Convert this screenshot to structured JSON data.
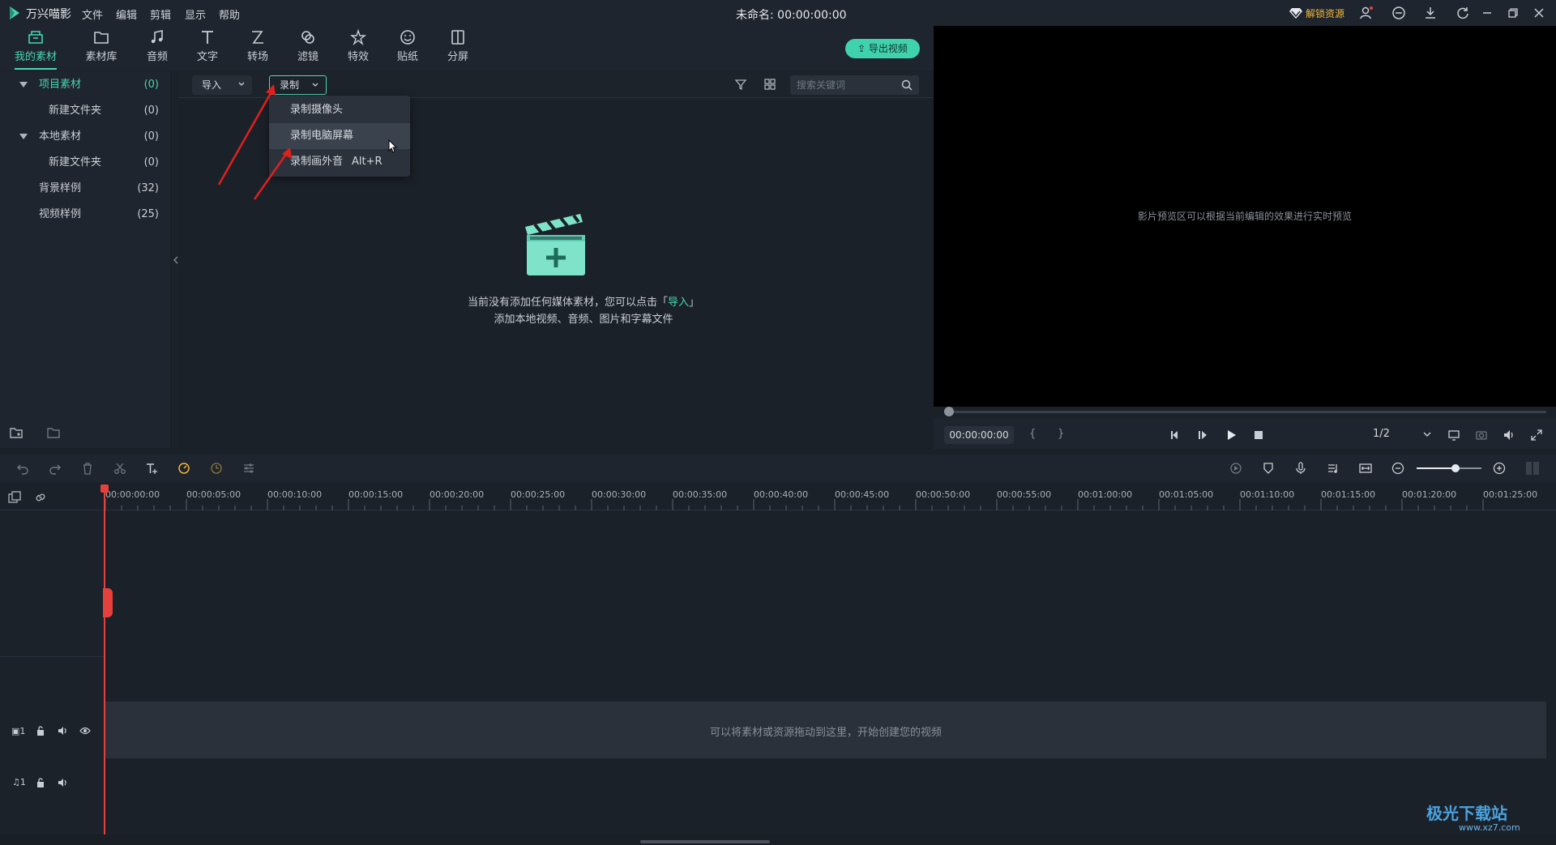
{
  "titlebar": {
    "app_name": "万兴喵影",
    "menus": [
      "文件",
      "编辑",
      "剪辑",
      "显示",
      "帮助"
    ],
    "doc_title": "未命名: 00:00:00:00",
    "unlock_label": "解锁资源",
    "window_icons": [
      "user-icon",
      "chat-icon",
      "download-icon",
      "refresh-icon",
      "minimize-icon",
      "maximize-icon",
      "close-icon"
    ]
  },
  "toolbar": {
    "tools": [
      {
        "label": "我的素材",
        "icon": "folder-box-icon",
        "active": true
      },
      {
        "label": "素材库",
        "icon": "folder-icon"
      },
      {
        "label": "音频",
        "icon": "music-icon"
      },
      {
        "label": "文字",
        "icon": "text-icon"
      },
      {
        "label": "转场",
        "icon": "transition-icon"
      },
      {
        "label": "滤镜",
        "icon": "filter-icon"
      },
      {
        "label": "特效",
        "icon": "effects-icon"
      },
      {
        "label": "贴纸",
        "icon": "sticker-icon"
      },
      {
        "label": "分屏",
        "icon": "split-screen-icon"
      }
    ],
    "export_label": "导出视频"
  },
  "left_panel": {
    "items": [
      {
        "name": "项目素材",
        "count": "(0)",
        "caret": true,
        "selected": true
      },
      {
        "name": "新建文件夹",
        "count": "(0)"
      },
      {
        "name": "本地素材",
        "count": "(0)",
        "caret": true
      },
      {
        "name": "新建文件夹",
        "count": "(0)"
      },
      {
        "name": "背景样例",
        "count": "(32)"
      },
      {
        "name": "视频样例",
        "count": "(25)"
      }
    ]
  },
  "media_toolbar": {
    "import_label": "导入",
    "record_label": "录制",
    "search_placeholder": "搜索关键词"
  },
  "record_menu": {
    "items": [
      {
        "label": "录制摄像头"
      },
      {
        "label": "录制电脑屏幕",
        "hover": true
      },
      {
        "label": "录制画外音",
        "shortcut": "Alt+R"
      }
    ]
  },
  "empty_state": {
    "line1_prefix": "当前没有添加任何媒体素材，您可以点击「",
    "line1_link": "导入",
    "line1_suffix": "」",
    "line2": "添加本地视频、音频、图片和字幕文件"
  },
  "preview": {
    "hint": "影片预览区可以根据当前编辑的效果进行实时预览",
    "timecode": "00:00:00:00",
    "ratio": "1/2",
    "progress": 0
  },
  "timeline": {
    "ticks": [
      "00:00:00:00",
      "00:00:05:00",
      "00:00:10:00",
      "00:00:15:00",
      "00:00:20:00",
      "00:00:25:00",
      "00:00:30:00",
      "00:00:35:00",
      "00:00:40:00",
      "00:00:45:00",
      "00:00:50:00",
      "00:00:55:00",
      "00:01:00:00",
      "00:01:05:00",
      "00:01:10:00",
      "00:01:15:00",
      "00:01:20:00",
      "00:01:25:00"
    ],
    "video_track_label": "1",
    "audio_track_label": "1",
    "drop_hint": "可以将素材或资源拖动到这里，开始创建您的视频",
    "zoom_level": 0.6
  },
  "watermark": {
    "text": "极光下载站",
    "url": "www.xz7.com"
  },
  "colors": {
    "accent": "#47d6b2",
    "background": "#1b2129",
    "playhead": "#e5403c",
    "unlock": "#f0b93a"
  }
}
